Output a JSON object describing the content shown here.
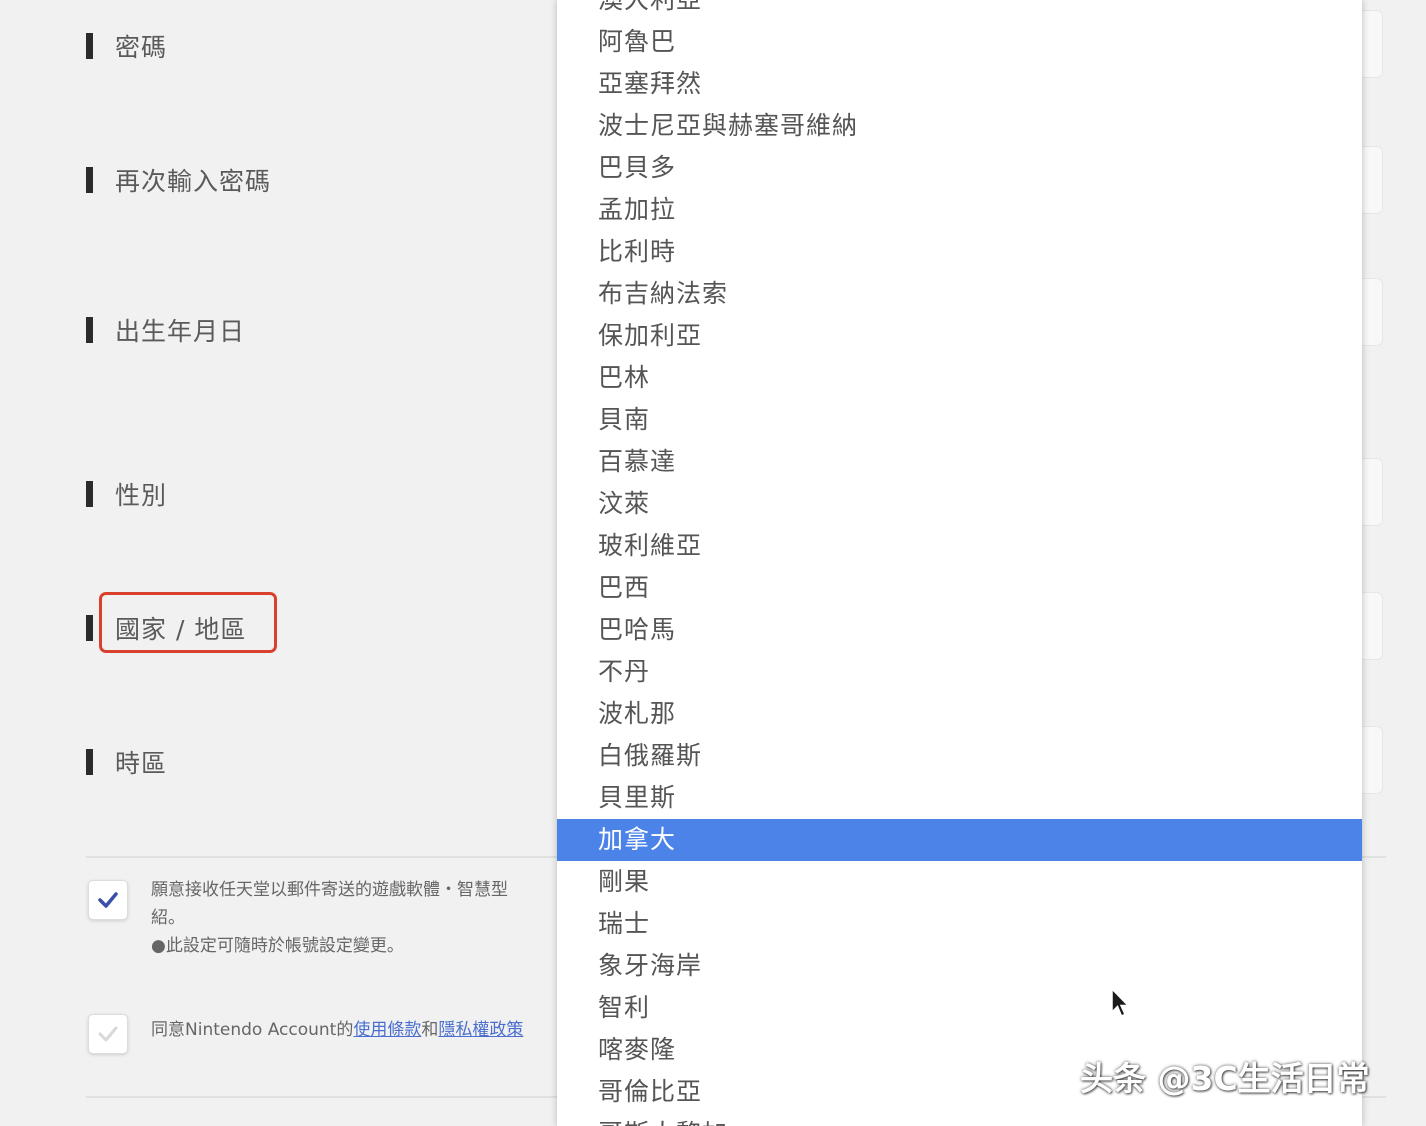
{
  "form": {
    "labels": [
      {
        "text": "密碼"
      },
      {
        "text": "再次輸入密碼"
      },
      {
        "text": "出生年月日"
      },
      {
        "text": "性別"
      },
      {
        "text": "國家 / 地區"
      },
      {
        "text": "時區"
      }
    ],
    "consent_newsletter": {
      "checked": true,
      "line1": "願意接收任天堂以郵件寄送的遊戲軟體・智慧型",
      "line2": "紹。",
      "line3": "●此設定可隨時於帳號設定變更。"
    },
    "consent_terms": {
      "checked": false,
      "prefix": "同意Nintendo Account的",
      "terms_link": "使用條款",
      "conjunction": "和",
      "privacy_link": "隱私權政策"
    }
  },
  "country_dropdown": {
    "items": [
      "澳大利亞",
      "阿魯巴",
      "亞塞拜然",
      "波士尼亞與赫塞哥維納",
      "巴貝多",
      "孟加拉",
      "比利時",
      "布吉納法索",
      "保加利亞",
      "巴林",
      "貝南",
      "百慕達",
      "汶萊",
      "玻利維亞",
      "巴西",
      "巴哈馬",
      "不丹",
      "波札那",
      "白俄羅斯",
      "貝里斯",
      "加拿大",
      "剛果",
      "瑞士",
      "象牙海岸",
      "智利",
      "喀麥隆",
      "哥倫比亞",
      "哥斯大黎加"
    ],
    "selected": "加拿大",
    "selected_color": "#4c83e8"
  },
  "highlight_color": "#d9412d",
  "watermark": "头条 @3C生活日常"
}
